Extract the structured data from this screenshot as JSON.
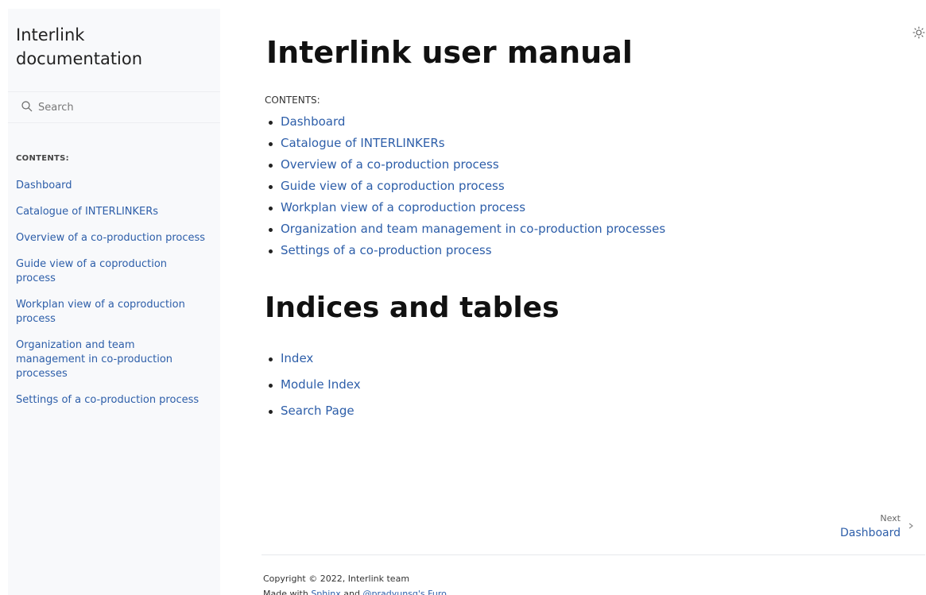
{
  "sidebar": {
    "brand": "Interlink documentation",
    "search": {
      "placeholder": "Search"
    },
    "caption": "CONTENTS:",
    "items": [
      {
        "label": "Dashboard"
      },
      {
        "label": "Catalogue of INTERLINKERs"
      },
      {
        "label": "Overview of a co-production process"
      },
      {
        "label": "Guide view of a coproduction process"
      },
      {
        "label": "Workplan view of a coproduction process"
      },
      {
        "label": "Organization and team management in co-production processes"
      },
      {
        "label": "Settings of a co-production process"
      }
    ]
  },
  "main": {
    "title": "Interlink user manual",
    "caption": "CONTENTS:",
    "toc": [
      {
        "label": "Dashboard"
      },
      {
        "label": "Catalogue of INTERLINKERs"
      },
      {
        "label": "Overview of a co-production process"
      },
      {
        "label": "Guide view of a coproduction process"
      },
      {
        "label": "Workplan view of a coproduction process"
      },
      {
        "label": "Organization and team management in co-production processes"
      },
      {
        "label": "Settings of a co-production process"
      }
    ],
    "indices_title": "Indices and tables",
    "indices": [
      {
        "label": "Index"
      },
      {
        "label": "Module Index"
      },
      {
        "label": "Search Page"
      }
    ]
  },
  "next": {
    "label": "Next",
    "title": "Dashboard"
  },
  "footer": {
    "copyright": "Copyright © 2022, Interlink team",
    "made_prefix": "Made with ",
    "sphinx": "Sphinx",
    "and": " and ",
    "furo": "@pradyunsg's Furo"
  },
  "colors": {
    "link": "#2d5ea9",
    "sidebar_bg": "#f8f9fb"
  },
  "icons": {
    "search": "search-icon",
    "theme": "sun-icon",
    "next": "chevron-right-icon"
  }
}
